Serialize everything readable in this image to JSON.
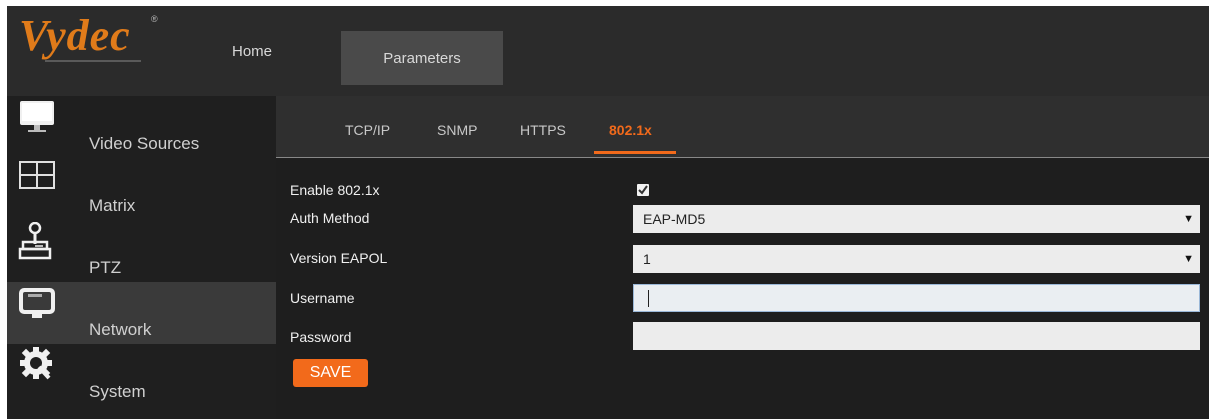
{
  "brand": {
    "name": "Vydec",
    "reg_mark": "®"
  },
  "nav": {
    "home": "Home",
    "parameters": "Parameters"
  },
  "sidebar": {
    "items": [
      {
        "label": "Video Sources",
        "icon": "monitor-icon"
      },
      {
        "label": "Matrix",
        "icon": "grid-icon"
      },
      {
        "label": "PTZ",
        "icon": "joystick-icon"
      },
      {
        "label": "Network",
        "icon": "network-device-icon"
      },
      {
        "label": "System",
        "icon": "gear-icon"
      }
    ],
    "active": "Network"
  },
  "tabs": [
    {
      "label": "TCP/IP"
    },
    {
      "label": "SNMP"
    },
    {
      "label": "HTTPS"
    },
    {
      "label": "802.1x"
    }
  ],
  "active_tab": "802.1x",
  "form": {
    "enable_label": "Enable 802.1x",
    "enable_checked": true,
    "auth_label": "Auth Method",
    "auth_value": "EAP-MD5",
    "eapol_label": "Version EAPOL",
    "eapol_value": "1",
    "username_label": "Username",
    "username_value": "",
    "password_label": "Password",
    "password_value": "",
    "save_label": "SAVE"
  },
  "colors": {
    "accent": "#f26a1b",
    "logo": "#e07b1a",
    "background": "#1e1e1e"
  }
}
